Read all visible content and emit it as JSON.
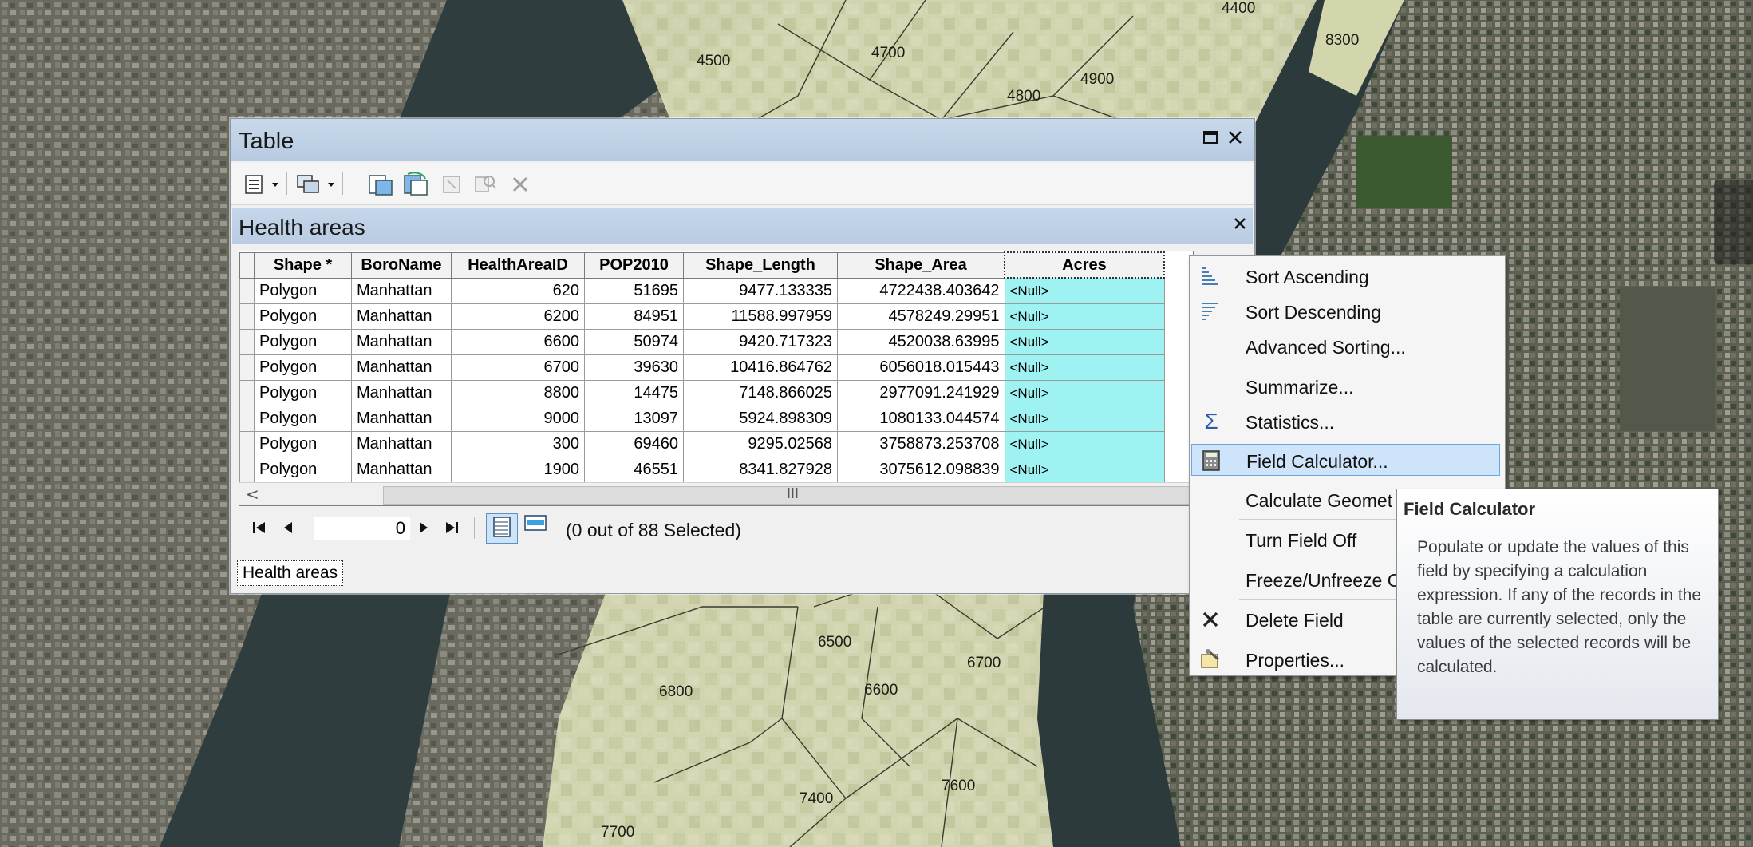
{
  "map": {
    "labels": [
      "4400",
      "8300",
      "4500",
      "4700",
      "4900",
      "4800",
      "6500",
      "6700",
      "6800",
      "6600",
      "7400",
      "7600",
      "7700"
    ]
  },
  "window": {
    "title": "Table",
    "maximize_icon": "maximize-icon",
    "close_icon": "close-icon"
  },
  "toolbar": {
    "icons": [
      "table-options-icon",
      "dropdown-icon",
      "related-tables-icon",
      "dropdown-icon",
      "select-by-attributes-icon",
      "switch-selection-icon",
      "clear-selection-icon",
      "zoom-to-selected-icon",
      "delete-selected-icon"
    ]
  },
  "layer": {
    "name": "Health areas",
    "close_icon": "close-icon",
    "tab_label": "Health areas"
  },
  "grid": {
    "columns": [
      "Shape *",
      "BoroName",
      "HealthAreaID",
      "POP2010",
      "Shape_Length",
      "Shape_Area",
      "Acres"
    ],
    "rows": [
      [
        "Polygon",
        "Manhattan",
        "620",
        "51695",
        "9477.133335",
        "4722438.403642",
        "<Null>"
      ],
      [
        "Polygon",
        "Manhattan",
        "6200",
        "84951",
        "11588.997959",
        "4578249.29951",
        "<Null>"
      ],
      [
        "Polygon",
        "Manhattan",
        "6600",
        "50974",
        "9420.717323",
        "4520038.63995",
        "<Null>"
      ],
      [
        "Polygon",
        "Manhattan",
        "6700",
        "39630",
        "10416.864762",
        "6056018.015443",
        "<Null>"
      ],
      [
        "Polygon",
        "Manhattan",
        "8800",
        "14475",
        "7148.866025",
        "2977091.241929",
        "<Null>"
      ],
      [
        "Polygon",
        "Manhattan",
        "9000",
        "13097",
        "5924.898309",
        "1080133.044574",
        "<Null>"
      ],
      [
        "Polygon",
        "Manhattan",
        "300",
        "69460",
        "9295.02568",
        "3758873.253708",
        "<Null>"
      ],
      [
        "Polygon",
        "Manhattan",
        "1900",
        "46551",
        "8341.827928",
        "3075612.098839",
        "<Null>"
      ]
    ],
    "scroll_left_icon": "<",
    "scroll_thumb_grip": "III"
  },
  "navigation": {
    "first_icon": "first-record-icon",
    "prev_icon": "previous-record-icon",
    "record_value": "0",
    "next_icon": "next-record-icon",
    "last_icon": "last-record-icon",
    "show_all_icon": "show-all-records-icon",
    "show_selected_icon": "show-selected-records-icon",
    "selected_text": "(0 out of 88 Selected)"
  },
  "context_menu": {
    "items": [
      {
        "label": "Sort Ascending",
        "icon": "sort-ascending-icon"
      },
      {
        "label": "Sort Descending",
        "icon": "sort-descending-icon"
      },
      {
        "label": "Advanced Sorting...",
        "icon": ""
      },
      {
        "label": "Summarize...",
        "icon": ""
      },
      {
        "label": "Statistics...",
        "icon": "sigma-icon"
      },
      {
        "label": "Field Calculator...",
        "icon": "calculator-icon"
      },
      {
        "label": "Calculate Geomet",
        "icon": ""
      },
      {
        "label": "Turn Field Off",
        "icon": ""
      },
      {
        "label": "Freeze/Unfreeze C",
        "icon": ""
      },
      {
        "label": "Delete Field",
        "icon": "delete-icon"
      },
      {
        "label": "Properties...",
        "icon": "properties-icon"
      }
    ]
  },
  "tooltip": {
    "title": "Field Calculator",
    "body": "Populate or update the values of this field by specifying a calculation expression. If any of the records in the table are currently selected, only the values of the selected records will be calculated."
  },
  "colors": {
    "title_bar": "#c0d2e8",
    "acres_cell": "#9ef2f2",
    "menu_highlight": "#cde4fb",
    "map_overlay": "#d8dcb4"
  }
}
